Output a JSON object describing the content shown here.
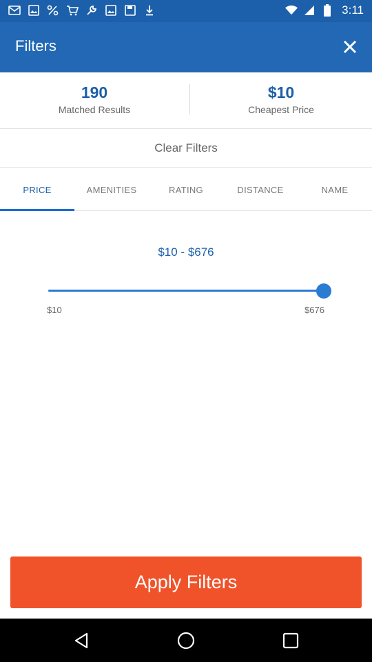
{
  "status_bar": {
    "time": "3:11",
    "icons_left": [
      "mail-icon",
      "photo-icon",
      "percent-icon",
      "cart-icon",
      "wrench-icon",
      "photo-icon",
      "save-icon",
      "download-icon"
    ],
    "icons_right": [
      "wifi-icon",
      "signal-icon",
      "battery-icon"
    ]
  },
  "app_bar": {
    "title": "Filters",
    "close_icon": "close-icon"
  },
  "stats": {
    "matched": {
      "value": "190",
      "label": "Matched Results"
    },
    "cheapest": {
      "value": "$10",
      "label": "Cheapest Price"
    }
  },
  "clear_filters_label": "Clear Filters",
  "tabs": [
    {
      "label": "PRICE",
      "active": true
    },
    {
      "label": "AMENITIES",
      "active": false
    },
    {
      "label": "RATING",
      "active": false
    },
    {
      "label": "DISTANCE",
      "active": false
    },
    {
      "label": "NAME",
      "active": false
    }
  ],
  "price_filter": {
    "range_label": "$10 - $676",
    "min_label": "$10",
    "max_label": "$676",
    "min": 10,
    "max": 676,
    "selected_min": 10,
    "selected_max": 676
  },
  "apply_button_label": "Apply Filters",
  "nav_bar": [
    "back-icon",
    "home-icon",
    "recents-icon"
  ],
  "colors": {
    "status_bar": "#1c5faa",
    "app_bar": "#2268b5",
    "accent": "#1c5faa",
    "slider": "#2a7bd2",
    "apply_button": "#f0532a"
  }
}
